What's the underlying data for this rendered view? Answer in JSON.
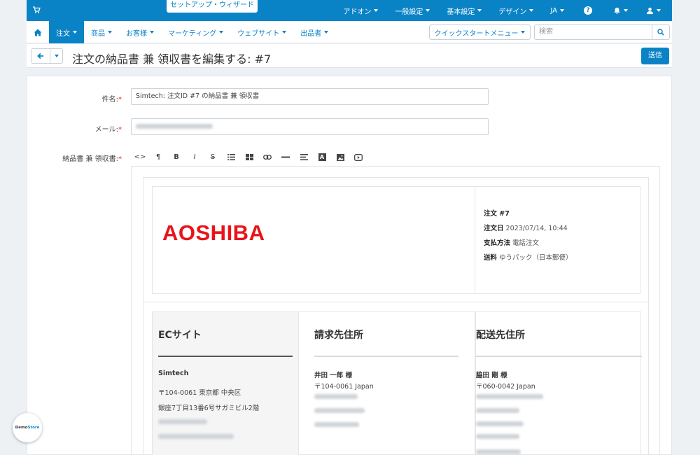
{
  "topbar": {
    "wizard_label": "セットアップ・ウィザード",
    "menu": [
      "アドオン",
      "一般設定",
      "基本設定",
      "デザイン",
      "JA"
    ],
    "help_glyph": "?"
  },
  "nav": {
    "items": [
      "注文",
      "商品",
      "お客様",
      "マーケティング",
      "ウェブサイト",
      "出品者"
    ],
    "quick_start": "クイックスタートメニュー",
    "search_placeholder": "検索"
  },
  "header": {
    "title": "注文の納品書 兼 領収書を編集する: #7",
    "send_label": "送信"
  },
  "form": {
    "subject_label": "件名:",
    "subject_value": "Simtech: 注文ID #7 の納品書 兼 領収書",
    "email_label": "メール:",
    "invoice_label": "納品書 兼 領収書:",
    "required_mark": "*"
  },
  "toolbar": {
    "buttons": [
      "<>",
      "¶",
      "B",
      "I",
      "S",
      "list",
      "table",
      "link",
      "hr",
      "align",
      "A",
      "image",
      "video"
    ]
  },
  "invoice": {
    "logo_text": "AOSHIBA",
    "order_no_label": "注文 #7",
    "order_date_label": "注文日",
    "order_date": "2023/07/14, 10:44",
    "payment_label": "支払方法",
    "payment": "電話注文",
    "shipping_label": "送料",
    "shipping": "ゆうパック（日本郵便）",
    "shop": {
      "title": "ECサイト",
      "name": "Simtech",
      "line1": "〒104-0061 東京都 中央区",
      "line2": "銀座7丁目13番6号サガミビル2階"
    },
    "billing": {
      "title": "請求先住所",
      "name": "井田 一郎 様",
      "line1": "〒104-0061 Japan"
    },
    "shipping_addr": {
      "title": "配送先住所",
      "name": "脇田 剛 様",
      "line1": "〒060-0042 Japan"
    }
  },
  "badge": {
    "text_a": "Demo",
    "text_b": "Store"
  },
  "colors": {
    "primary": "#0a83c6",
    "logo": "#e8141a",
    "required": "#e02020"
  }
}
